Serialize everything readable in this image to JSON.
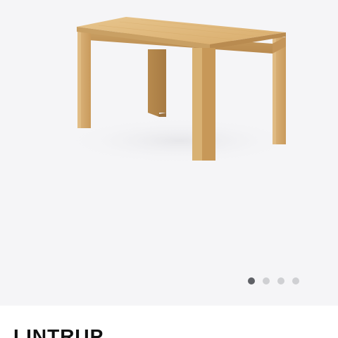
{
  "product": {
    "title": "LINTRUP",
    "image_icon": "dining-table-image"
  },
  "carousel": {
    "slide_count": 4,
    "active_index": 0
  },
  "colors": {
    "background": "#f5f5f7",
    "wood": "#d9ae72",
    "dot_active": "#5f6166",
    "dot_inactive": "#cfd0d3"
  }
}
